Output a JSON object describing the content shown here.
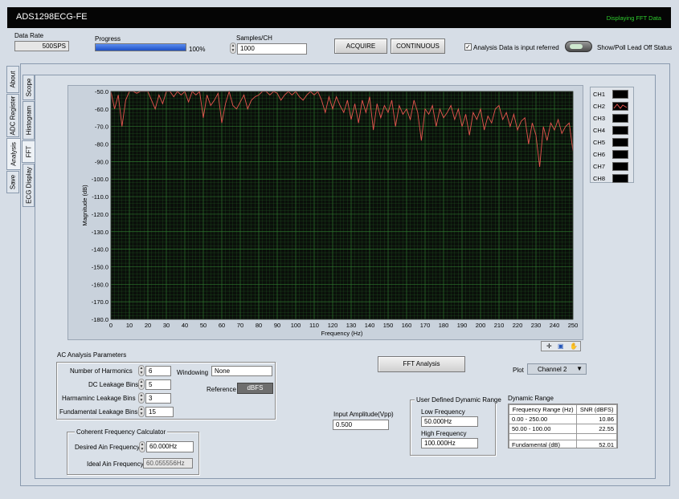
{
  "window": {
    "title": "ADS1298ECG-FE",
    "status": "Displaying FFT Data"
  },
  "top": {
    "data_rate_label": "Data Rate",
    "data_rate_value": "500SPS",
    "progress_label": "Progress",
    "progress_value": 100,
    "progress_text": "100%",
    "samples_label": "Samples/CH",
    "samples_value": "1000",
    "acquire_label": "ACQUIRE",
    "continuous_label": "CONTINUOUS",
    "input_referred_label": "Analysis Data is input referred",
    "input_referred_checked": true,
    "lead_off_label": "Show/Poll Lead Off Status"
  },
  "left_tabs": [
    "About",
    "ADC Register",
    "Analysis",
    "Save"
  ],
  "sub_tabs": [
    "Scope",
    "Histogram",
    "FFT",
    "ECG Display"
  ],
  "chart_data": {
    "type": "line",
    "xlabel": "Frequency (Hz)",
    "ylabel": "Magnitude (dB)",
    "xlim": [
      0,
      250
    ],
    "ylim": [
      -180,
      -50
    ],
    "xticks": [
      "0",
      "10",
      "20",
      "30",
      "40",
      "50",
      "60",
      "70",
      "80",
      "90",
      "100",
      "110",
      "120",
      "130",
      "140",
      "150",
      "160",
      "170",
      "180",
      "190",
      "200",
      "210",
      "220",
      "230",
      "240",
      "250"
    ],
    "yticks": [
      "-50.0",
      "-60.0",
      "-70.0",
      "-80.0",
      "-90.0",
      "-100.0",
      "-110.0",
      "-120.0",
      "-130.0",
      "-140.0",
      "-150.0",
      "-160.0",
      "-170.0",
      "-180.0"
    ],
    "grid": true,
    "background": "#0a0f0a",
    "grid_color": "#2f7a2f",
    "series": [
      {
        "name": "CH2",
        "color": "#e8554f",
        "x": [
          0,
          2,
          4,
          6,
          8,
          10,
          12,
          14,
          16,
          18,
          20,
          22,
          24,
          26,
          28,
          30,
          32,
          34,
          36,
          38,
          40,
          42,
          44,
          46,
          48,
          50,
          52,
          54,
          56,
          58,
          60,
          62,
          64,
          66,
          68,
          70,
          72,
          74,
          76,
          78,
          80,
          82,
          84,
          86,
          88,
          90,
          92,
          94,
          96,
          98,
          100,
          102,
          104,
          106,
          108,
          110,
          112,
          114,
          116,
          118,
          120,
          122,
          124,
          126,
          128,
          130,
          132,
          134,
          136,
          138,
          140,
          142,
          144,
          146,
          148,
          150,
          152,
          154,
          156,
          158,
          160,
          162,
          164,
          166,
          168,
          170,
          172,
          174,
          176,
          178,
          180,
          182,
          184,
          186,
          188,
          190,
          192,
          194,
          196,
          198,
          200,
          202,
          204,
          206,
          208,
          210,
          212,
          214,
          216,
          218,
          220,
          222,
          224,
          226,
          228,
          230,
          232,
          234,
          236,
          238,
          240,
          242,
          244,
          246,
          248,
          250
        ],
        "y": [
          -50,
          -60,
          -52,
          -70,
          -55,
          -50,
          -50,
          -51,
          -50,
          -50,
          -50,
          -55,
          -60,
          -52,
          -57,
          -50,
          -50,
          -53,
          -50,
          -52,
          -50,
          -56,
          -50,
          -52,
          -50,
          -65,
          -52,
          -58,
          -55,
          -51,
          -68,
          -57,
          -50,
          -58,
          -60,
          -56,
          -52,
          -60,
          -55,
          -53,
          -52,
          -50,
          -50,
          -52,
          -50,
          -51,
          -55,
          -52,
          -50,
          -52,
          -50,
          -53,
          -55,
          -52,
          -50,
          -52,
          -50,
          -55,
          -62,
          -53,
          -60,
          -53,
          -58,
          -62,
          -55,
          -66,
          -57,
          -68,
          -55,
          -62,
          -53,
          -72,
          -57,
          -65,
          -58,
          -62,
          -55,
          -70,
          -58,
          -63,
          -60,
          -66,
          -55,
          -62,
          -78,
          -60,
          -63,
          -58,
          -70,
          -60,
          -65,
          -62,
          -58,
          -66,
          -60,
          -70,
          -63,
          -75,
          -62,
          -66,
          -60,
          -72,
          -64,
          -68,
          -60,
          -58,
          -66,
          -62,
          -70,
          -63,
          -72,
          -67,
          -65,
          -80,
          -68,
          -75,
          -93,
          -70,
          -78,
          -68,
          -72,
          -66,
          -74,
          -70,
          -68,
          -84
        ]
      }
    ]
  },
  "chart_tools": [
    "cursor-tool",
    "zoom-tool",
    "pan-tool"
  ],
  "legend": [
    "CH1",
    "CH2",
    "CH3",
    "CH4",
    "CH5",
    "CH6",
    "CH7",
    "CH8"
  ],
  "ac_params": {
    "title": "AC Analysis Parameters",
    "harmonics_label": "Number of Harmonics",
    "harmonics_value": "6",
    "dc_leak_label": "DC Leakage Bins",
    "dc_leak_value": "5",
    "harm_leak_label": "Harmaminc Leakage Bins",
    "harm_leak_value": "3",
    "fund_leak_label": "Fundamental Leakage Bins",
    "fund_leak_value": "15",
    "windowing_label": "Windowing",
    "windowing_value": "None",
    "reference_label": "Reference",
    "reference_value": "dBFS"
  },
  "coherent": {
    "title": "Coherent Frequency Calculator",
    "desired_label": "Desired Ain Frequency",
    "desired_value": "60.000Hz",
    "ideal_label": "Ideal Ain Frequency",
    "ideal_value": "60.055556Hz"
  },
  "fft_button": "FFT Analysis",
  "input_amp": {
    "label": "Input Amplitude(Vpp)",
    "value": "0.500"
  },
  "udr": {
    "title": "User Defined Dynamic Range",
    "low_label": "Low Frequency",
    "low_value": "50.000Hz",
    "high_label": "High Frequency",
    "high_value": "100.000Hz"
  },
  "plot_select": {
    "label": "Plot",
    "value": "Channel 2"
  },
  "dynamic_range": {
    "title": "Dynamic Range",
    "headers": [
      "Frequency Range (Hz)",
      "SNR (dBFS)"
    ],
    "rows": [
      [
        "0.00 - 250.00",
        "10.86"
      ],
      [
        "50.00 - 100.00",
        "22.55"
      ],
      [
        "",
        ""
      ],
      [
        "Fundamental (dB)",
        "52.01"
      ]
    ]
  }
}
